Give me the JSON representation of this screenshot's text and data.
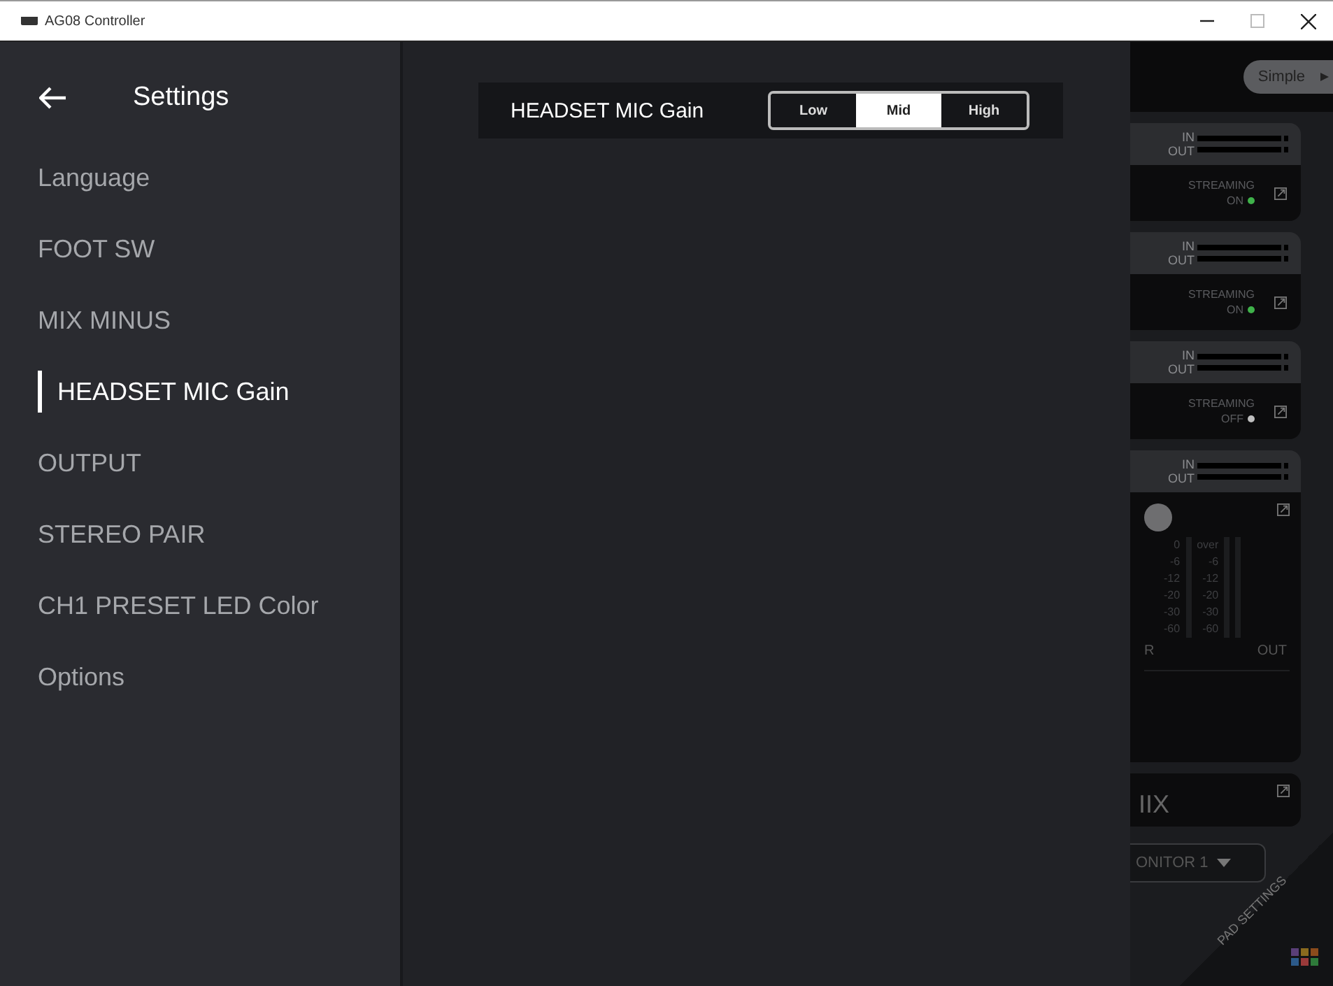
{
  "window": {
    "title": "AG08 Controller"
  },
  "sidebar": {
    "title": "Settings",
    "items": [
      {
        "label": "Language",
        "selected": false
      },
      {
        "label": "FOOT SW",
        "selected": false
      },
      {
        "label": "MIX MINUS",
        "selected": false
      },
      {
        "label": "HEADSET MIC Gain",
        "selected": true
      },
      {
        "label": "OUTPUT",
        "selected": false
      },
      {
        "label": "STEREO PAIR",
        "selected": false
      },
      {
        "label": "CH1 PRESET LED Color",
        "selected": false
      },
      {
        "label": "Options",
        "selected": false
      }
    ]
  },
  "setting": {
    "label": "HEADSET MIC Gain",
    "options": [
      {
        "label": "Low",
        "selected": false
      },
      {
        "label": "Mid",
        "selected": true
      },
      {
        "label": "High",
        "selected": false
      }
    ]
  },
  "background_panel": {
    "mode_button": "Simple",
    "channels": [
      {
        "in_label": "IN",
        "out_label": "OUT",
        "streaming_label": "STREAMING",
        "status": "ON",
        "color": "#3fb24a"
      },
      {
        "in_label": "IN",
        "out_label": "OUT",
        "streaming_label": "STREAMING",
        "status": "ON",
        "color": "#3fb24a"
      },
      {
        "in_label": "IN",
        "out_label": "OUT",
        "streaming_label": "STREAMING",
        "status": "OFF",
        "color": "#bfbfbf"
      }
    ],
    "meter_card": {
      "in_label": "IN",
      "out_label": "OUT",
      "left_scale": [
        "0",
        "-6",
        "-12",
        "-20",
        "-30",
        "-60"
      ],
      "right_scale": [
        "over",
        "-6",
        "-12",
        "-20",
        "-30",
        "-60"
      ],
      "left_label": "R",
      "right_label": "OUT"
    },
    "mix_title": "IIX",
    "monitor_select": "ONITOR 1",
    "pad_settings": "PAD SETTINGS"
  }
}
